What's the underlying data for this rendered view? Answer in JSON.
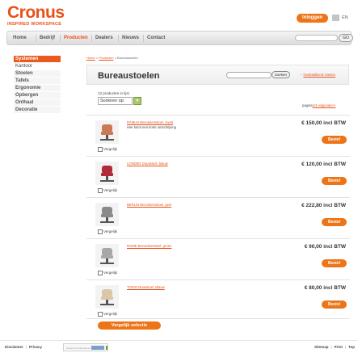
{
  "header": {
    "logo_main": "Cronus",
    "logo_sub": "INSPIRED WORKSPACE",
    "login_label": "Inloggen",
    "lang": "EN"
  },
  "nav": {
    "items": [
      "Home",
      "Bedrijf",
      "Producten",
      "Dealers",
      "Nieuws",
      "Contact"
    ],
    "active": "Producten",
    "search_placeholder": "",
    "go_label": "GO"
  },
  "sidebar": {
    "items": [
      {
        "label": "Systemen",
        "state": "active"
      },
      {
        "label": "Kantoor",
        "state": "sub"
      },
      {
        "label": "Stoelen",
        "state": "normal"
      },
      {
        "label": "Tafels",
        "state": "normal"
      },
      {
        "label": "Ergonomie",
        "state": "normal"
      },
      {
        "label": "Opbergen",
        "state": "normal"
      },
      {
        "label": "Onthaal",
        "state": "normal"
      },
      {
        "label": "Decoratie",
        "state": "normal"
      }
    ]
  },
  "breadcrumb": {
    "home": "Home",
    "sep1": " > ",
    "producten": "Producten",
    "sep2": " > ",
    "current": "Bureaustoelen"
  },
  "page": {
    "title": "Bureaustoelen",
    "search_placeholder": "",
    "search_button": "Zoeken",
    "advanced_link": "Gedetailleerd zoeken",
    "count_text": "12 producten in lijst",
    "sort_label": "Sorteren op:",
    "page_prefix": "pagina",
    "page_link": "1/3 volgende>>"
  },
  "products": [
    {
      "name": "RAMUS Bezoekersstoel, zwart",
      "desc": "Hier komt een korte omschrijving",
      "price": "€ 150,00 incl BTW",
      "compare": "Vergelijk",
      "order": "Bestel",
      "color": "#c97a55"
    },
    {
      "name": "LONDEN Draaistoel, blauw",
      "desc": "",
      "price": "€ 120,00 incl BTW",
      "compare": "Vergelijk",
      "order": "Bestel",
      "color": "#b02a3a"
    },
    {
      "name": "BERLIN Bezoekersstoel, geel",
      "desc": "",
      "price": "€ 222,80 incl BTW",
      "compare": "Vergelijk",
      "order": "Bestel",
      "color": "#8a8a8a"
    },
    {
      "name": "ROME Bezoekersstoel, groen",
      "desc": "",
      "price": "€ 90,00 incl BTW",
      "compare": "Vergelijk",
      "order": "Bestel",
      "color": "#a8a8a8"
    },
    {
      "name": "TOKIO Draaistoel, Blauw",
      "desc": "",
      "price": "€ 80,00 incl BTW",
      "compare": "Vergelijk",
      "order": "Bestel",
      "color": "#d8c8a8"
    }
  ],
  "compare_selection_label": "Vergelijk selectie",
  "footer": {
    "left": [
      "Disclaimer",
      "Privacy"
    ],
    "powered": "powered by Bussiness",
    "right": [
      "Sitemap",
      "Print",
      "Top"
    ]
  }
}
